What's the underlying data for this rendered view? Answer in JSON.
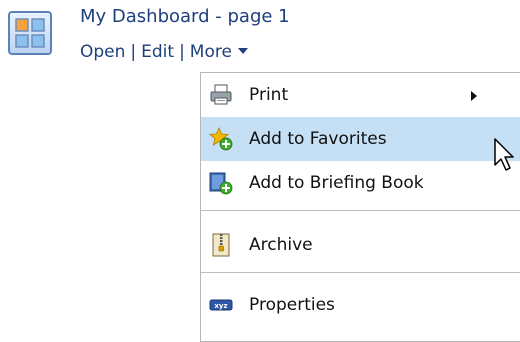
{
  "header": {
    "title": "My Dashboard - page 1",
    "icon": "dashboard-grid-icon"
  },
  "actions": {
    "open": "Open",
    "edit": "Edit",
    "more": "More",
    "separator": "|"
  },
  "menu": {
    "items": [
      {
        "label": "Print",
        "icon": "printer-icon",
        "has_submenu": true
      },
      {
        "label": "Add to Favorites",
        "icon": "favorite-star-add-icon",
        "highlighted": true
      },
      {
        "label": "Add to Briefing Book",
        "icon": "briefing-book-add-icon"
      },
      {
        "label": "Archive",
        "icon": "archive-zip-icon"
      },
      {
        "label": "Properties",
        "icon": "properties-xyz-icon"
      }
    ]
  },
  "colors": {
    "link": "#1d3f7c",
    "highlight": "#c5dff5",
    "menu_border": "#b7b7b7"
  }
}
